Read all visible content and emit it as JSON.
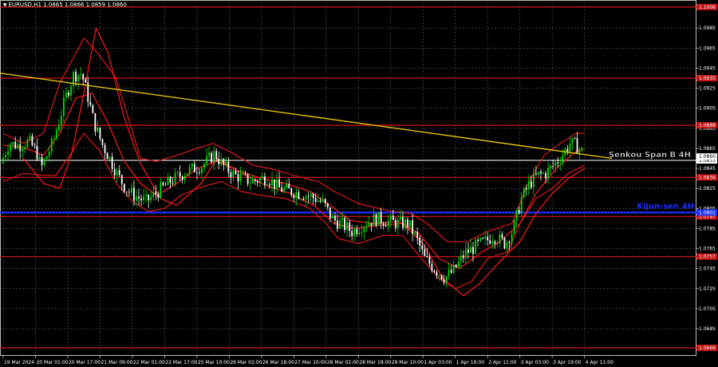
{
  "window": {
    "title": "EURUSD,H1  1.0865 1.0866 1.0859 1.0860"
  },
  "colors": {
    "background": "#000000",
    "grid": "#5a5a5a",
    "candle_up": "#00e000",
    "candle_down": "#ffffff",
    "ichimoku": "#ff1a1a",
    "bollinger": "#e01818",
    "trendline": "#e6c200",
    "level": "#c41414",
    "level_tag_bg": "#c41414",
    "senkou": "#d8d8d8",
    "kijun": "#1a2eff",
    "axis_text": "#ffffff"
  },
  "labels": {
    "senkou": "Senkou Span B 4H",
    "kijun": "Kijun-sen 4H"
  },
  "chart_data": {
    "type": "candlestick",
    "symbol": "EURUSD",
    "timeframe": "H1",
    "ylim": [
      1.0658,
      1.1013
    ],
    "y_ticks": [
      "1.0985",
      "1.0965",
      "1.0945",
      "1.0925",
      "1.0905",
      "1.0885",
      "1.0865",
      "1.0845",
      "1.0825",
      "1.0805",
      "1.0785",
      "1.0765",
      "1.0745",
      "1.0725",
      "1.0705",
      "1.0685"
    ],
    "x_ticks": [
      "19 Mar 2024",
      "20 Mar 01:00",
      "20 Mar 17:00",
      "21 Mar 09:00",
      "22 Mar 01:00",
      "22 Mar 17:00",
      "25 Mar 10:00",
      "26 Mar 02:00",
      "26 Mar 18:00",
      "27 Mar 10:00",
      "28 Mar 02:00",
      "28 Mar 18:00",
      "29 Mar 10:00",
      "1 Apr 03:00",
      "1 Apr 19:00",
      "2 Apr 11:00",
      "3 Apr 03:00",
      "3 Apr 19:00",
      "4 Apr 11:00"
    ],
    "current_price": "1.0860",
    "levels": [
      {
        "value": 1.1006,
        "label": "1.1006"
      },
      {
        "value": 1.0935,
        "label": "1.0935"
      },
      {
        "value": 1.0888,
        "label": "1.0888"
      },
      {
        "value": 1.0836,
        "label": "1.0836"
      },
      {
        "value": 1.0797,
        "label": "1.0797"
      },
      {
        "value": 1.0757,
        "label": "1.0757"
      },
      {
        "value": 1.0666,
        "label": "1.0666"
      }
    ],
    "senkou_span_b": {
      "value": 1.0853,
      "label": "1.0853"
    },
    "kijun_sen": {
      "value": 1.0801,
      "label": "1.0801"
    },
    "trendline": {
      "start": [
        0,
        1.094
      ],
      "end": [
        1.0,
        1.0855
      ]
    },
    "price_path": [
      [
        0,
        1.085
      ],
      [
        0.2,
        1.087
      ],
      [
        0.45,
        1.0868
      ],
      [
        0.7,
        1.0872
      ],
      [
        0.9,
        1.086
      ],
      [
        1.0,
        1.0845
      ],
      [
        1.3,
        1.0872
      ],
      [
        1.6,
        1.0915
      ],
      [
        1.8,
        1.0938
      ],
      [
        2.0,
        1.094
      ],
      [
        2.15,
        1.0918
      ],
      [
        2.3,
        1.0892
      ],
      [
        2.5,
        1.087
      ],
      [
        2.7,
        1.0855
      ],
      [
        2.9,
        1.0838
      ],
      [
        3.1,
        1.0825
      ],
      [
        3.3,
        1.0818
      ],
      [
        3.6,
        1.0812
      ],
      [
        3.9,
        1.0822
      ],
      [
        4.2,
        1.0832
      ],
      [
        4.6,
        1.0842
      ],
      [
        5.0,
        1.0848
      ],
      [
        5.3,
        1.086
      ],
      [
        5.5,
        1.0848
      ],
      [
        5.8,
        1.0838
      ],
      [
        6.2,
        1.0832
      ],
      [
        6.6,
        1.0836
      ],
      [
        6.9,
        1.0825
      ],
      [
        7.2,
        1.0822
      ],
      [
        7.6,
        1.0818
      ],
      [
        7.8,
        1.0815
      ],
      [
        8.0,
        1.081
      ],
      [
        8.2,
        1.0795
      ],
      [
        8.5,
        1.0788
      ],
      [
        8.7,
        1.0782
      ],
      [
        9.0,
        1.079
      ],
      [
        9.3,
        1.0795
      ],
      [
        9.6,
        1.0792
      ],
      [
        9.9,
        1.079
      ],
      [
        10.1,
        1.079
      ],
      [
        10.3,
        1.0775
      ],
      [
        10.5,
        1.0755
      ],
      [
        10.8,
        1.0743
      ],
      [
        11.0,
        1.0736
      ],
      [
        11.2,
        1.0742
      ],
      [
        11.5,
        1.076
      ],
      [
        11.8,
        1.0768
      ],
      [
        12.0,
        1.0772
      ],
      [
        12.2,
        1.0778
      ],
      [
        12.5,
        1.077
      ],
      [
        12.7,
        1.0785
      ],
      [
        12.9,
        1.0815
      ],
      [
        13.1,
        1.083
      ],
      [
        13.3,
        1.0838
      ],
      [
        13.5,
        1.084
      ],
      [
        13.7,
        1.0848
      ],
      [
        13.9,
        1.0858
      ],
      [
        14.1,
        1.087
      ],
      [
        14.25,
        1.0868
      ],
      [
        14.4,
        1.0862
      ]
    ],
    "bollinger_upper": [
      [
        0,
        1.088
      ],
      [
        0.5,
        1.087
      ],
      [
        1.0,
        1.088
      ],
      [
        1.4,
        1.093
      ],
      [
        1.8,
        1.096
      ],
      [
        2.0,
        1.0975
      ],
      [
        2.3,
        1.0962
      ],
      [
        2.8,
        1.0935
      ],
      [
        3.1,
        1.0895
      ],
      [
        3.4,
        1.0855
      ],
      [
        3.8,
        1.0852
      ],
      [
        4.3,
        1.0858
      ],
      [
        4.8,
        1.0865
      ],
      [
        5.2,
        1.087
      ],
      [
        5.6,
        1.0862
      ],
      [
        6.2,
        1.0848
      ],
      [
        6.6,
        1.0845
      ],
      [
        7.2,
        1.0838
      ],
      [
        7.8,
        1.0832
      ],
      [
        8.2,
        1.0822
      ],
      [
        8.8,
        1.081
      ],
      [
        9.5,
        1.0803
      ],
      [
        10.1,
        1.08
      ],
      [
        10.5,
        1.079
      ],
      [
        11.0,
        1.0772
      ],
      [
        11.5,
        1.0772
      ],
      [
        12.0,
        1.0782
      ],
      [
        12.6,
        1.079
      ],
      [
        13.0,
        1.083
      ],
      [
        13.4,
        1.0858
      ],
      [
        13.8,
        1.087
      ],
      [
        14.2,
        1.088
      ],
      [
        14.4,
        1.088
      ]
    ],
    "bollinger_lower": [
      [
        0,
        1.0832
      ],
      [
        0.5,
        1.084
      ],
      [
        1.0,
        1.0838
      ],
      [
        1.3,
        1.0838
      ],
      [
        1.6,
        1.0855
      ],
      [
        2.0,
        1.088
      ],
      [
        2.4,
        1.0862
      ],
      [
        2.8,
        1.083
      ],
      [
        3.2,
        1.0812
      ],
      [
        3.6,
        1.0802
      ],
      [
        4.0,
        1.0805
      ],
      [
        4.4,
        1.0818
      ],
      [
        4.8,
        1.0825
      ],
      [
        5.4,
        1.0832
      ],
      [
        5.9,
        1.0822
      ],
      [
        6.4,
        1.0818
      ],
      [
        7.0,
        1.0815
      ],
      [
        7.6,
        1.0805
      ],
      [
        8.0,
        1.079
      ],
      [
        8.3,
        1.0775
      ],
      [
        8.8,
        1.077
      ],
      [
        9.4,
        1.0778
      ],
      [
        9.9,
        1.0778
      ],
      [
        10.3,
        1.0758
      ],
      [
        10.8,
        1.0735
      ],
      [
        11.2,
        1.0725
      ],
      [
        11.6,
        1.0732
      ],
      [
        12.0,
        1.0755
      ],
      [
        12.5,
        1.0762
      ],
      [
        12.8,
        1.079
      ],
      [
        13.2,
        1.0815
      ],
      [
        13.6,
        1.0825
      ],
      [
        14.0,
        1.084
      ],
      [
        14.4,
        1.0848
      ]
    ],
    "ichimoku_fast": [
      [
        0,
        1.0868
      ],
      [
        0.5,
        1.0866
      ],
      [
        1.0,
        1.0858
      ],
      [
        1.4,
        1.088
      ],
      [
        1.8,
        1.0915
      ],
      [
        2.2,
        1.092
      ],
      [
        2.6,
        1.089
      ],
      [
        3.0,
        1.0852
      ],
      [
        3.4,
        1.083
      ],
      [
        3.8,
        1.0818
      ],
      [
        4.3,
        1.083
      ],
      [
        4.8,
        1.0845
      ],
      [
        5.3,
        1.0852
      ],
      [
        5.8,
        1.0843
      ],
      [
        6.4,
        1.0835
      ],
      [
        7.0,
        1.083
      ],
      [
        7.6,
        1.0822
      ],
      [
        8.1,
        1.0808
      ],
      [
        8.6,
        1.0793
      ],
      [
        9.2,
        1.079
      ],
      [
        9.8,
        1.0792
      ],
      [
        10.3,
        1.078
      ],
      [
        10.8,
        1.0755
      ],
      [
        11.3,
        1.0745
      ],
      [
        11.8,
        1.076
      ],
      [
        12.3,
        1.0772
      ],
      [
        12.8,
        1.079
      ],
      [
        13.2,
        1.082
      ],
      [
        13.7,
        1.0845
      ],
      [
        14.2,
        1.0862
      ],
      [
        14.4,
        1.0864
      ]
    ],
    "ichimoku_slow": [
      [
        0.5,
        1.0855
      ],
      [
        1.0,
        1.083
      ],
      [
        1.4,
        1.0825
      ],
      [
        1.7,
        1.086
      ],
      [
        2.0,
        1.092
      ],
      [
        2.3,
        1.0985
      ],
      [
        2.6,
        1.096
      ],
      [
        3.0,
        1.0895
      ],
      [
        3.4,
        1.085
      ],
      [
        3.9,
        1.0815
      ],
      [
        4.3,
        1.0808
      ],
      [
        4.9,
        1.083
      ],
      [
        5.3,
        1.0855
      ],
      [
        5.9,
        1.084
      ],
      [
        6.5,
        1.0828
      ],
      [
        7.1,
        1.082
      ],
      [
        7.7,
        1.0808
      ],
      [
        8.2,
        1.079
      ],
      [
        8.7,
        1.0785
      ],
      [
        9.3,
        1.0788
      ],
      [
        9.9,
        1.079
      ],
      [
        10.4,
        1.077
      ],
      [
        10.9,
        1.0735
      ],
      [
        11.4,
        1.0718
      ],
      [
        11.8,
        1.073
      ],
      [
        12.3,
        1.0752
      ],
      [
        12.8,
        1.0772
      ],
      [
        13.2,
        1.08
      ],
      [
        13.6,
        1.082
      ],
      [
        14.0,
        1.0835
      ],
      [
        14.4,
        1.0845
      ]
    ]
  }
}
